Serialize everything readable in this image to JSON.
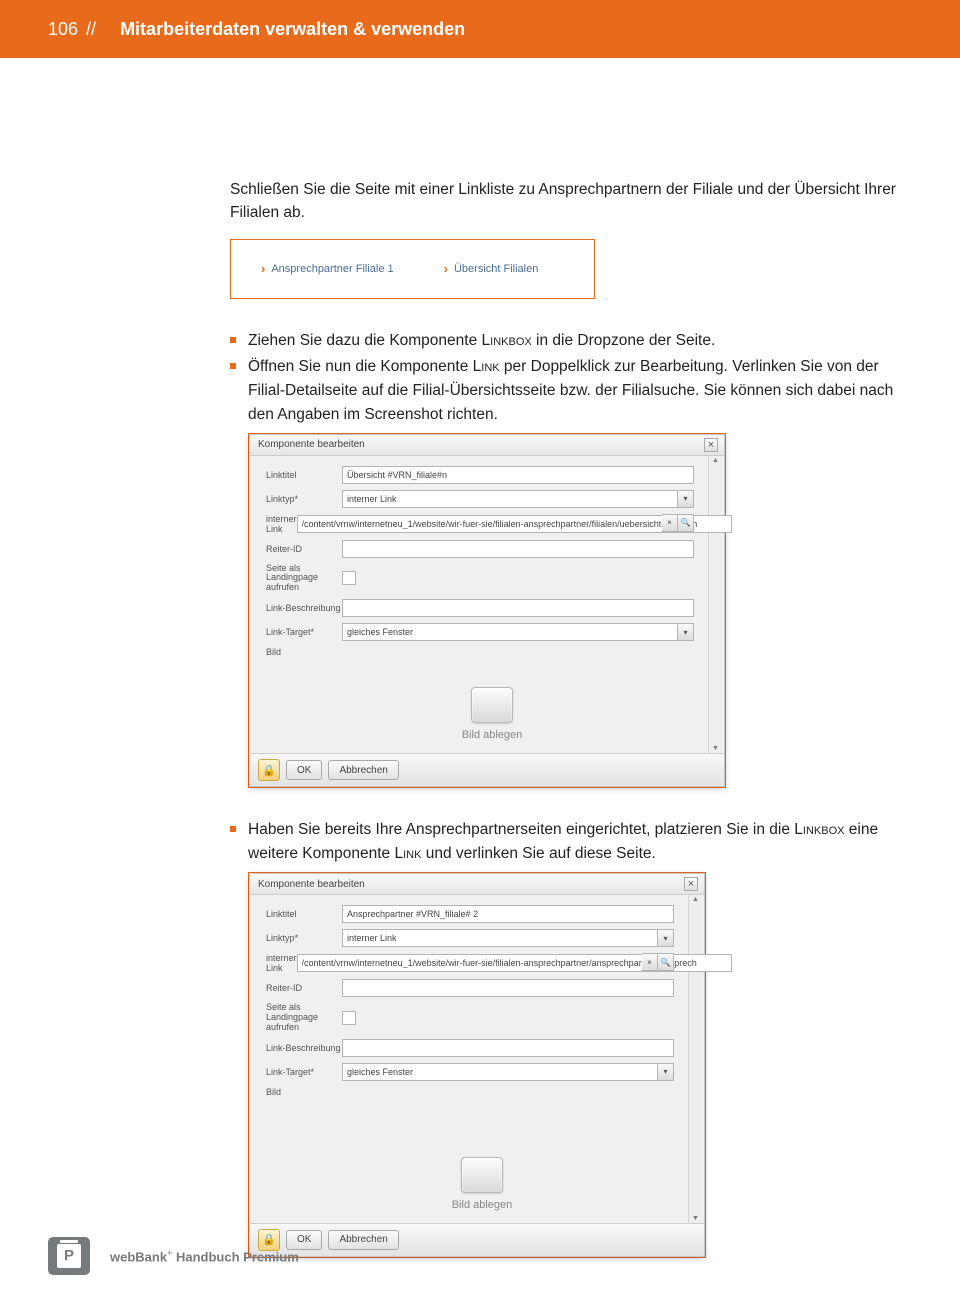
{
  "header": {
    "page_number": "106",
    "separator": "//",
    "title": "Mitarbeiterdaten verwalten & verwenden"
  },
  "intro_paragraph": "Schließen Sie die Seite mit einer Linkliste zu Ansprechpartnern der Filiale und der Übersicht Ihrer Filialen ab.",
  "linklist": {
    "item1": "Ansprechpartner Filiale 1",
    "item2": "Übersicht Filialen"
  },
  "bullets_1": {
    "b1_pre": "Ziehen Sie dazu die Komponente ",
    "b1_sc": "Linkbox",
    "b1_post": " in die Dropzone der Seite.",
    "b2_pre": "Öffnen Sie nun die Komponente ",
    "b2_sc": "Link",
    "b2_post": " per Doppelklick zur Bearbeitung. Verlinken Sie von der Filial-Detailseite auf die Filial-Übersichtsseite bzw. der Filialsuche. Sie können sich dabei nach den Angaben im Screenshot richten."
  },
  "dialog1": {
    "title": "Komponente bearbeiten",
    "fields": {
      "linktitel_label": "Linktitel",
      "linktitel_value": "Übersicht #VRN_filiale#n",
      "linktyp_label": "Linktyp*",
      "linktyp_value": "interner Link",
      "interner_label": "interner Link",
      "interner_value": "/content/vrnw/internetneu_1/website/wir-fuer-sie/filialen-ansprechpartner/filialen/uebersicht-filialen.h",
      "reiter_label": "Reiter-ID",
      "landing_label": "Seite als Landingpage aufrufen",
      "beschr_label": "Link-Beschreibung",
      "target_label": "Link-Target*",
      "target_value": "gleiches Fenster",
      "bild_label": "Bild"
    },
    "image_drop": "Bild ablegen",
    "ok": "OK",
    "cancel": "Abbrechen"
  },
  "bullets_2": {
    "b1_pre": "Haben Sie bereits Ihre Ansprechpartnerseiten eingerichtet, platzieren Sie in die ",
    "b1_sc1": "Linkbox",
    "b1_mid": " eine weitere Komponente ",
    "b1_sc2": "Link",
    "b1_post": " und verlinken Sie auf diese Seite."
  },
  "dialog2": {
    "title": "Komponente bearbeiten",
    "fields": {
      "linktitel_label": "Linktitel",
      "linktitel_value": "Ansprechpartner #VRN_filiale# 2",
      "linktyp_label": "Linktyp*",
      "linktyp_value": "interner Link",
      "interner_label": "interner Link",
      "interner_value": "/content/vrnw/internetneu_1/website/wir-fuer-sie/filialen-ansprechpartner/ansprechpartner/ansprech",
      "reiter_label": "Reiter-ID",
      "landing_label": "Seite als Landingpage aufrufen",
      "beschr_label": "Link-Beschreibung",
      "target_label": "Link-Target*",
      "target_value": "gleiches Fenster",
      "bild_label": "Bild"
    },
    "image_drop": "Bild ablegen",
    "ok": "OK",
    "cancel": "Abbrechen"
  },
  "footer": {
    "icon_letter": "P",
    "brand_pre": "webBank",
    "brand_plus": "+",
    "brand_post": " Handbuch Premium"
  }
}
